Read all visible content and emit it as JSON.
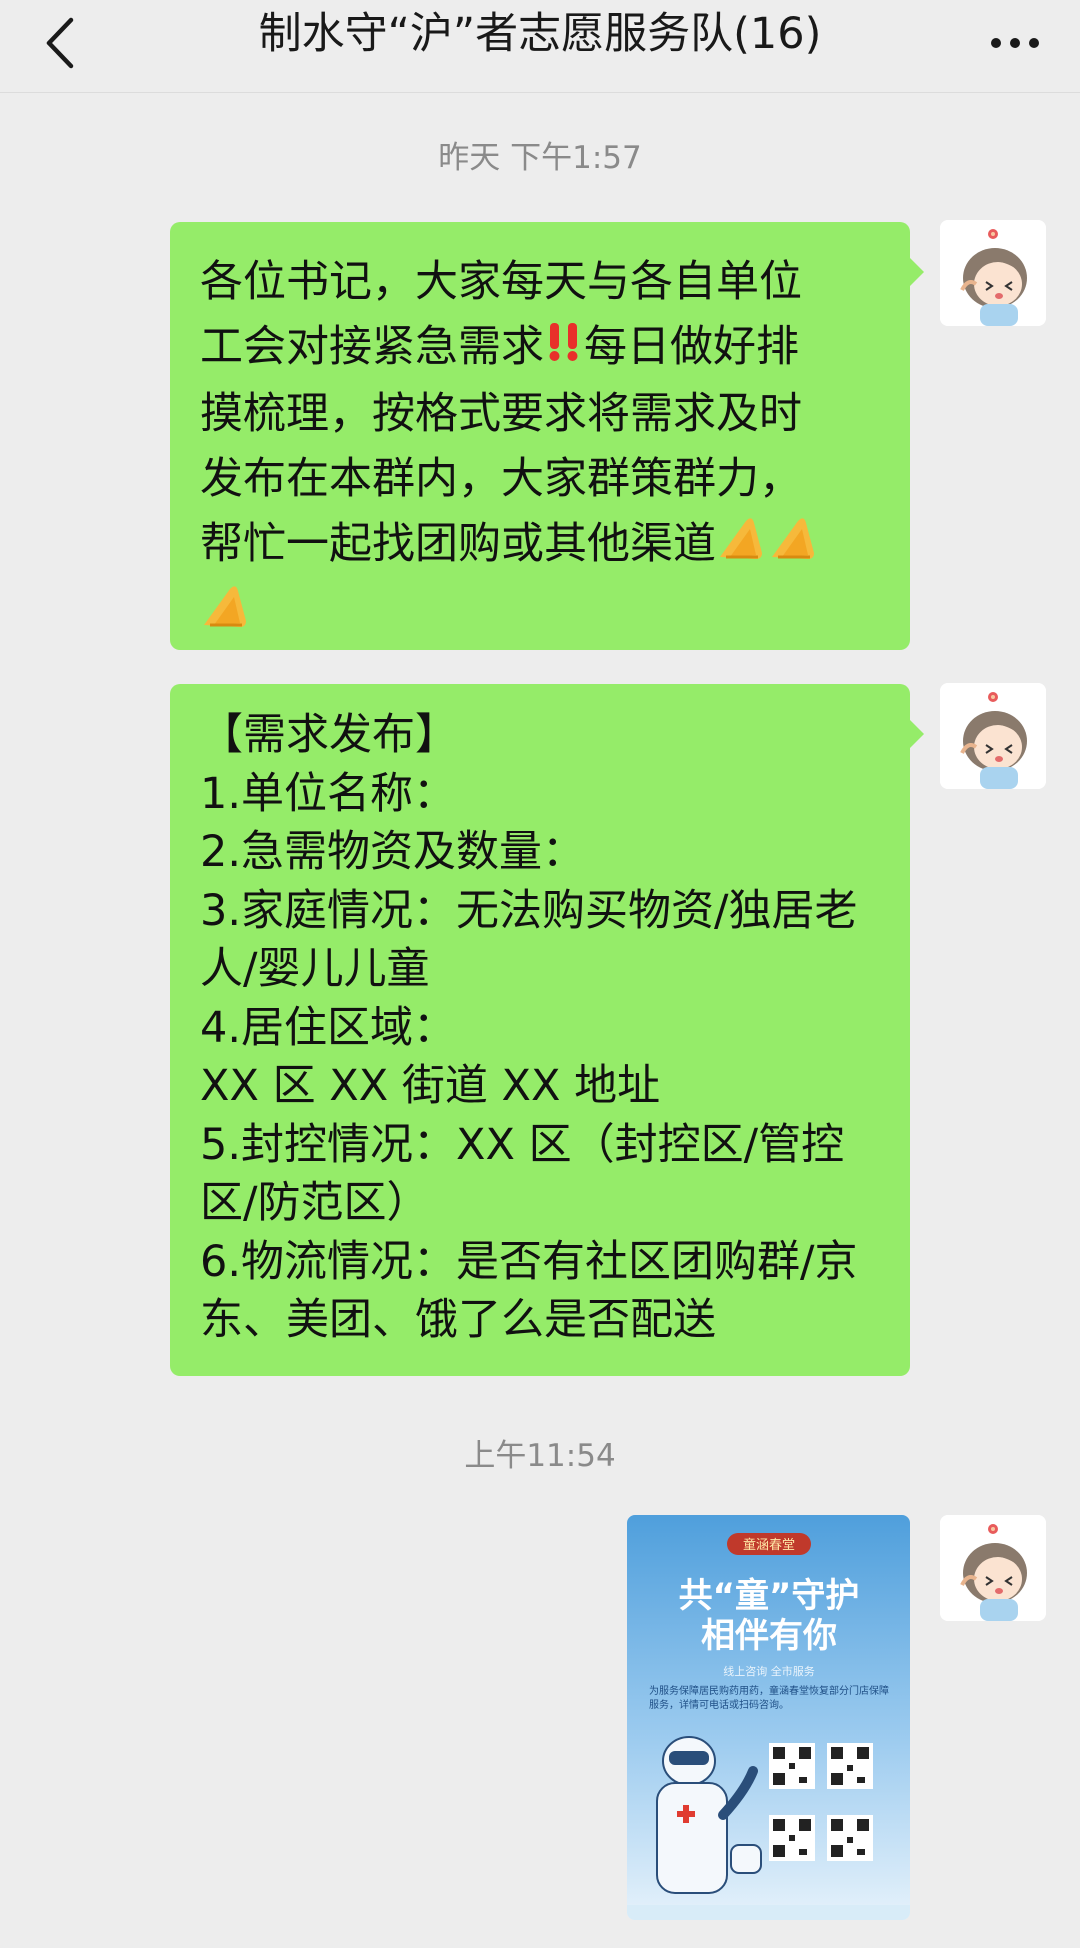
{
  "header": {
    "title": "制水守“沪”者志愿服务队(16)",
    "back_icon": "chevron-left-icon",
    "more_icon": "ellipsis-icon"
  },
  "messages": [
    {
      "time": "昨天 下午1:57",
      "bubbles": [
        {
          "lines": [
            "各位书记，大家每天与各自单位",
            "工会对接紧急需求",
            "每日做好排",
            "摸梳理，按格式要求将需求及时",
            "发布在本群内，大家群策群力，",
            "帮忙一起找团购或其他渠道"
          ],
          "emoji_inline": [
            "double-exclamation-icon",
            "pray-hands-icon"
          ]
        },
        {
          "lines": [
            "【需求发布】",
            "1.单位名称：",
            "2.急需物资及数量：",
            "3.家庭情况：无法购买物资/独居老",
            "人/婴儿儿童",
            "4.居住区域：",
            "XX 区 XX 街道 XX 地址",
            "5.封控情况：XX 区（封控区/管控",
            "区/防范区）",
            "6.物流情况：是否有社区团购群/京",
            "东、美团、饿了么是否配送"
          ]
        }
      ]
    },
    {
      "time": "上午11:54",
      "image": {
        "brand": "童涵春堂",
        "headline_1": "共“童”守护",
        "headline_2": "相伴有你",
        "tagline": "线上咨询  全市服务",
        "body": "为服务保障居民购药用药，童涵春堂恢复部分门店保障服务，详情可电话或扫码咨询。"
      }
    }
  ],
  "colors": {
    "background": "#ededed",
    "bubble": "#95ec69",
    "timestamp": "#8a8a8a",
    "poster_blue": "#5aa8e0"
  }
}
